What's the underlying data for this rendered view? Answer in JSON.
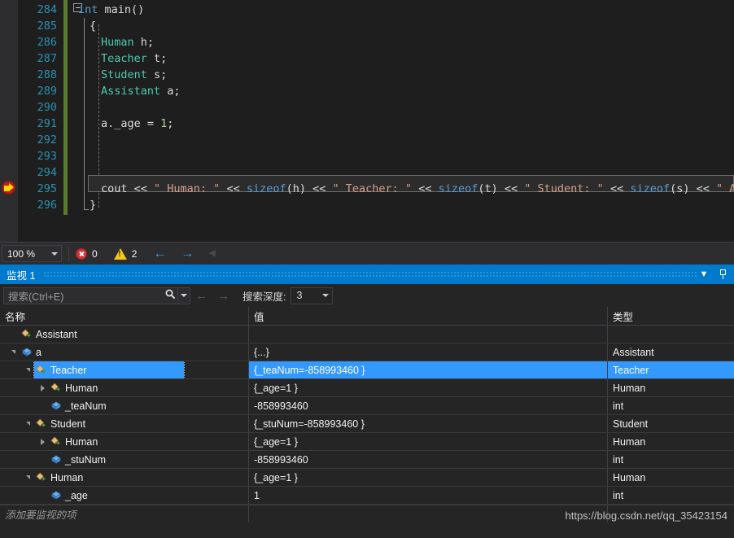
{
  "editor": {
    "lines": [
      {
        "num": "284",
        "segments": [
          {
            "t": "int ",
            "c": "kw"
          },
          {
            "t": "main",
            "c": "plain"
          },
          {
            "t": "()",
            "c": "plain"
          }
        ]
      },
      {
        "num": "285",
        "segments": [
          {
            "t": "{",
            "c": "plain"
          }
        ],
        "indent": 1
      },
      {
        "num": "286",
        "segments": [
          {
            "t": "Human",
            "c": "type"
          },
          {
            "t": " h;",
            "c": "plain"
          }
        ],
        "indent": 2
      },
      {
        "num": "287",
        "segments": [
          {
            "t": "Teacher",
            "c": "type"
          },
          {
            "t": " t;",
            "c": "plain"
          }
        ],
        "indent": 2
      },
      {
        "num": "288",
        "segments": [
          {
            "t": "Student",
            "c": "type"
          },
          {
            "t": " s;",
            "c": "plain"
          }
        ],
        "indent": 2
      },
      {
        "num": "289",
        "segments": [
          {
            "t": "Assistant",
            "c": "type"
          },
          {
            "t": " a;",
            "c": "plain"
          }
        ],
        "indent": 2
      },
      {
        "num": "290",
        "segments": []
      },
      {
        "num": "291",
        "segments": [
          {
            "t": "a._age = ",
            "c": "plain"
          },
          {
            "t": "1",
            "c": "num"
          },
          {
            "t": ";",
            "c": "plain"
          }
        ],
        "indent": 2
      },
      {
        "num": "292",
        "segments": []
      },
      {
        "num": "293",
        "segments": []
      },
      {
        "num": "294",
        "segments": []
      },
      {
        "num": "295",
        "segments": [
          {
            "t": "cout << ",
            "c": "plain"
          },
          {
            "t": "\" Human: \"",
            "c": "str"
          },
          {
            "t": " << ",
            "c": "plain"
          },
          {
            "t": "sizeof",
            "c": "kw"
          },
          {
            "t": "(h) << ",
            "c": "plain"
          },
          {
            "t": "\" Teacher: \"",
            "c": "str"
          },
          {
            "t": " << ",
            "c": "plain"
          },
          {
            "t": "sizeof",
            "c": "kw"
          },
          {
            "t": "(t) << ",
            "c": "plain"
          },
          {
            "t": "\" Student: \"",
            "c": "str"
          },
          {
            "t": " << ",
            "c": "plain"
          },
          {
            "t": "sizeof",
            "c": "kw"
          },
          {
            "t": "(s) << ",
            "c": "plain"
          },
          {
            "t": "\" A",
            "c": "str"
          }
        ],
        "indent": 2,
        "current": true
      },
      {
        "num": "296",
        "segments": [
          {
            "t": "}",
            "c": "plain"
          }
        ],
        "indent": 1
      }
    ]
  },
  "statusbar": {
    "zoom_level": "100 %",
    "error_count": "0",
    "warning_count": "2",
    "back_arrow": "←",
    "forward_arrow": "→",
    "collapse_arrow": "◀"
  },
  "watch": {
    "title": "监视 1",
    "dropdown_glyph": "▼",
    "search": {
      "placeholder": "搜索(Ctrl+E)",
      "magnifier_glyph": "🔍",
      "dropdown_glyph": "▾",
      "prev_glyph": "←",
      "next_glyph": "→",
      "depth_label": "搜索深度:",
      "depth_value": "3"
    },
    "columns": [
      "名称",
      "值",
      "类型"
    ],
    "rows": [
      {
        "indent": 0,
        "expander": "none",
        "icon": "class-icon",
        "name": "Assistant",
        "value": "",
        "type": ""
      },
      {
        "indent": 0,
        "expander": "expanded",
        "icon": "field-icon",
        "name": "a",
        "value": "{...}",
        "type": "Assistant"
      },
      {
        "indent": 1,
        "expander": "expanded",
        "icon": "class-icon",
        "name": "Teacher",
        "value": "{_teaNum=-858993460 }",
        "type": "Teacher",
        "selected": true
      },
      {
        "indent": 2,
        "expander": "collapsed",
        "icon": "class-icon",
        "name": "Human",
        "value": "{_age=1 }",
        "type": "Human"
      },
      {
        "indent": 2,
        "expander": "none",
        "icon": "field-icon",
        "name": "_teaNum",
        "value": "-858993460",
        "type": "int"
      },
      {
        "indent": 1,
        "expander": "expanded",
        "icon": "class-icon",
        "name": "Student",
        "value": "{_stuNum=-858993460 }",
        "type": "Student"
      },
      {
        "indent": 2,
        "expander": "collapsed",
        "icon": "class-icon",
        "name": "Human",
        "value": "{_age=1 }",
        "type": "Human"
      },
      {
        "indent": 2,
        "expander": "none",
        "icon": "field-icon",
        "name": "_stuNum",
        "value": "-858993460",
        "type": "int"
      },
      {
        "indent": 1,
        "expander": "expanded",
        "icon": "class-icon",
        "name": "Human",
        "value": "{_age=1 }",
        "type": "Human"
      },
      {
        "indent": 2,
        "expander": "none",
        "icon": "field-icon",
        "name": "_age",
        "value": "1",
        "type": "int"
      }
    ],
    "add_row_placeholder": "添加要监视的项"
  },
  "watermark": "https://blog.csdn.net/qq_35423154",
  "colors": {
    "selection_blue": "#3399ff",
    "title_blue": "#007acc",
    "editor_bg": "#1e1e1e",
    "panel_bg": "#252526",
    "linenum": "#2b91af",
    "string": "#d69d85",
    "keyword": "#569cd6",
    "type": "#4ec9b0",
    "change_bar_green": "#5a7a30"
  }
}
